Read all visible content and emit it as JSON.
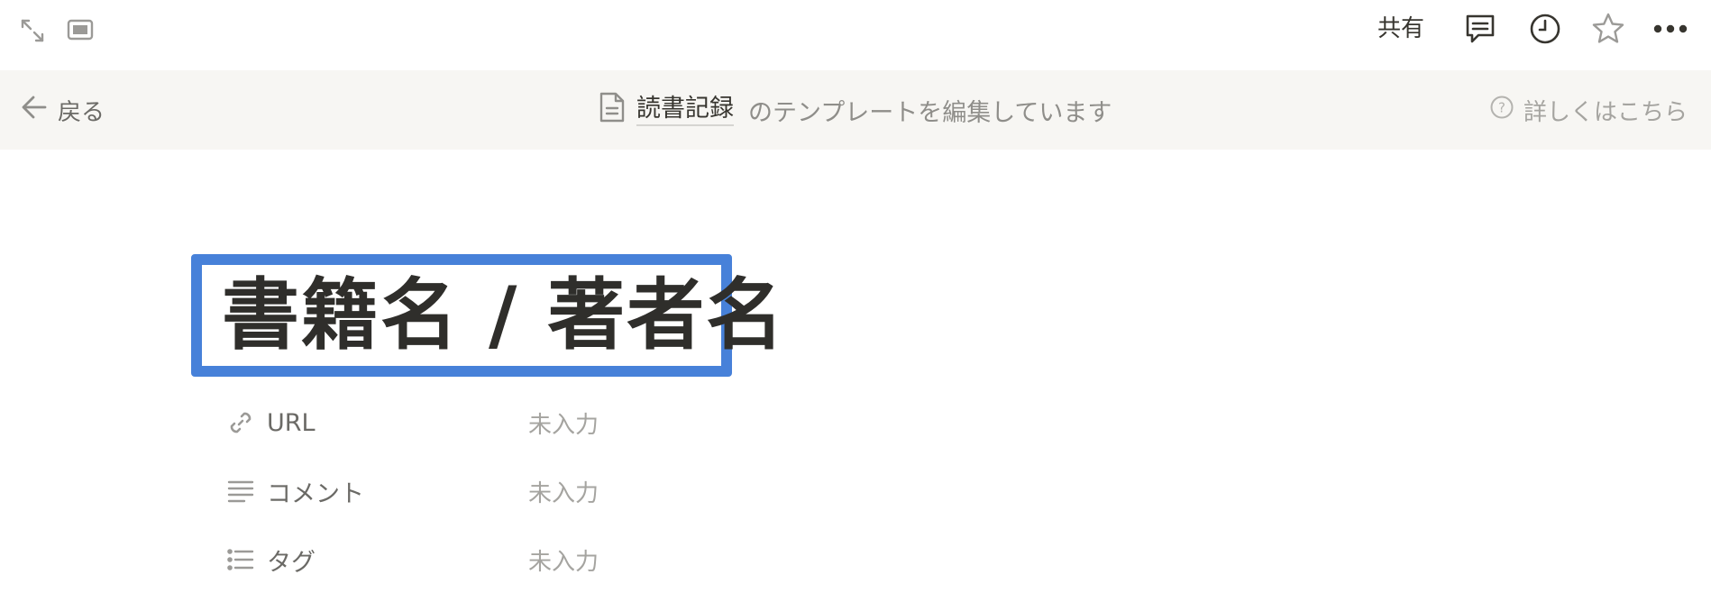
{
  "topbar": {
    "share_label": "共有",
    "icons": [
      "expand-icon",
      "peek-mode-icon",
      "comment-icon",
      "clock-icon",
      "star-icon",
      "more-icon"
    ]
  },
  "banner": {
    "back_label": "戻る",
    "template_doc": "読書記録",
    "editing_message": "のテンプレートを編集しています",
    "learn_more": "詳しくはこちら"
  },
  "page": {
    "title": "書籍名 / 著者名",
    "highlight_color": "#4781d9"
  },
  "properties": [
    {
      "name": "URL",
      "value": "未入力",
      "icon": "link-icon"
    },
    {
      "name": "コメント",
      "value": "未入力",
      "icon": "text-icon"
    },
    {
      "name": "タグ",
      "value": "未入力",
      "icon": "list-icon"
    }
  ]
}
